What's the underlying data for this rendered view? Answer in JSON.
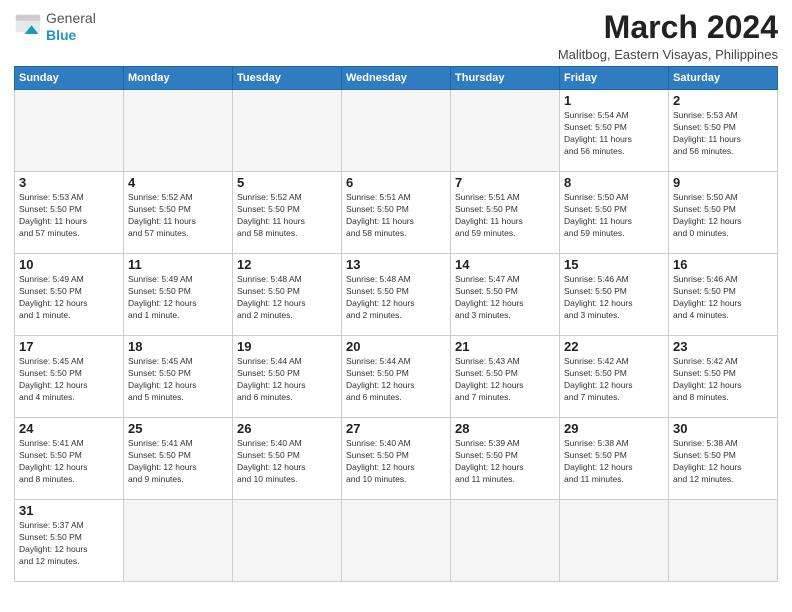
{
  "header": {
    "logo_general": "General",
    "logo_blue": "Blue",
    "main_title": "March 2024",
    "subtitle": "Malitbog, Eastern Visayas, Philippines"
  },
  "weekdays": [
    "Sunday",
    "Monday",
    "Tuesday",
    "Wednesday",
    "Thursday",
    "Friday",
    "Saturday"
  ],
  "weeks": [
    [
      {
        "day": "",
        "info": ""
      },
      {
        "day": "",
        "info": ""
      },
      {
        "day": "",
        "info": ""
      },
      {
        "day": "",
        "info": ""
      },
      {
        "day": "",
        "info": ""
      },
      {
        "day": "1",
        "info": "Sunrise: 5:54 AM\nSunset: 5:50 PM\nDaylight: 11 hours\nand 56 minutes."
      },
      {
        "day": "2",
        "info": "Sunrise: 5:53 AM\nSunset: 5:50 PM\nDaylight: 11 hours\nand 56 minutes."
      }
    ],
    [
      {
        "day": "3",
        "info": "Sunrise: 5:53 AM\nSunset: 5:50 PM\nDaylight: 11 hours\nand 57 minutes."
      },
      {
        "day": "4",
        "info": "Sunrise: 5:52 AM\nSunset: 5:50 PM\nDaylight: 11 hours\nand 57 minutes."
      },
      {
        "day": "5",
        "info": "Sunrise: 5:52 AM\nSunset: 5:50 PM\nDaylight: 11 hours\nand 58 minutes."
      },
      {
        "day": "6",
        "info": "Sunrise: 5:51 AM\nSunset: 5:50 PM\nDaylight: 11 hours\nand 58 minutes."
      },
      {
        "day": "7",
        "info": "Sunrise: 5:51 AM\nSunset: 5:50 PM\nDaylight: 11 hours\nand 59 minutes."
      },
      {
        "day": "8",
        "info": "Sunrise: 5:50 AM\nSunset: 5:50 PM\nDaylight: 11 hours\nand 59 minutes."
      },
      {
        "day": "9",
        "info": "Sunrise: 5:50 AM\nSunset: 5:50 PM\nDaylight: 12 hours\nand 0 minutes."
      }
    ],
    [
      {
        "day": "10",
        "info": "Sunrise: 5:49 AM\nSunset: 5:50 PM\nDaylight: 12 hours\nand 1 minute."
      },
      {
        "day": "11",
        "info": "Sunrise: 5:49 AM\nSunset: 5:50 PM\nDaylight: 12 hours\nand 1 minute."
      },
      {
        "day": "12",
        "info": "Sunrise: 5:48 AM\nSunset: 5:50 PM\nDaylight: 12 hours\nand 2 minutes."
      },
      {
        "day": "13",
        "info": "Sunrise: 5:48 AM\nSunset: 5:50 PM\nDaylight: 12 hours\nand 2 minutes."
      },
      {
        "day": "14",
        "info": "Sunrise: 5:47 AM\nSunset: 5:50 PM\nDaylight: 12 hours\nand 3 minutes."
      },
      {
        "day": "15",
        "info": "Sunrise: 5:46 AM\nSunset: 5:50 PM\nDaylight: 12 hours\nand 3 minutes."
      },
      {
        "day": "16",
        "info": "Sunrise: 5:46 AM\nSunset: 5:50 PM\nDaylight: 12 hours\nand 4 minutes."
      }
    ],
    [
      {
        "day": "17",
        "info": "Sunrise: 5:45 AM\nSunset: 5:50 PM\nDaylight: 12 hours\nand 4 minutes."
      },
      {
        "day": "18",
        "info": "Sunrise: 5:45 AM\nSunset: 5:50 PM\nDaylight: 12 hours\nand 5 minutes."
      },
      {
        "day": "19",
        "info": "Sunrise: 5:44 AM\nSunset: 5:50 PM\nDaylight: 12 hours\nand 6 minutes."
      },
      {
        "day": "20",
        "info": "Sunrise: 5:44 AM\nSunset: 5:50 PM\nDaylight: 12 hours\nand 6 minutes."
      },
      {
        "day": "21",
        "info": "Sunrise: 5:43 AM\nSunset: 5:50 PM\nDaylight: 12 hours\nand 7 minutes."
      },
      {
        "day": "22",
        "info": "Sunrise: 5:42 AM\nSunset: 5:50 PM\nDaylight: 12 hours\nand 7 minutes."
      },
      {
        "day": "23",
        "info": "Sunrise: 5:42 AM\nSunset: 5:50 PM\nDaylight: 12 hours\nand 8 minutes."
      }
    ],
    [
      {
        "day": "24",
        "info": "Sunrise: 5:41 AM\nSunset: 5:50 PM\nDaylight: 12 hours\nand 8 minutes."
      },
      {
        "day": "25",
        "info": "Sunrise: 5:41 AM\nSunset: 5:50 PM\nDaylight: 12 hours\nand 9 minutes."
      },
      {
        "day": "26",
        "info": "Sunrise: 5:40 AM\nSunset: 5:50 PM\nDaylight: 12 hours\nand 10 minutes."
      },
      {
        "day": "27",
        "info": "Sunrise: 5:40 AM\nSunset: 5:50 PM\nDaylight: 12 hours\nand 10 minutes."
      },
      {
        "day": "28",
        "info": "Sunrise: 5:39 AM\nSunset: 5:50 PM\nDaylight: 12 hours\nand 11 minutes."
      },
      {
        "day": "29",
        "info": "Sunrise: 5:38 AM\nSunset: 5:50 PM\nDaylight: 12 hours\nand 11 minutes."
      },
      {
        "day": "30",
        "info": "Sunrise: 5:38 AM\nSunset: 5:50 PM\nDaylight: 12 hours\nand 12 minutes."
      }
    ],
    [
      {
        "day": "31",
        "info": "Sunrise: 5:37 AM\nSunset: 5:50 PM\nDaylight: 12 hours\nand 12 minutes."
      },
      {
        "day": "",
        "info": ""
      },
      {
        "day": "",
        "info": ""
      },
      {
        "day": "",
        "info": ""
      },
      {
        "day": "",
        "info": ""
      },
      {
        "day": "",
        "info": ""
      },
      {
        "day": "",
        "info": ""
      }
    ]
  ]
}
